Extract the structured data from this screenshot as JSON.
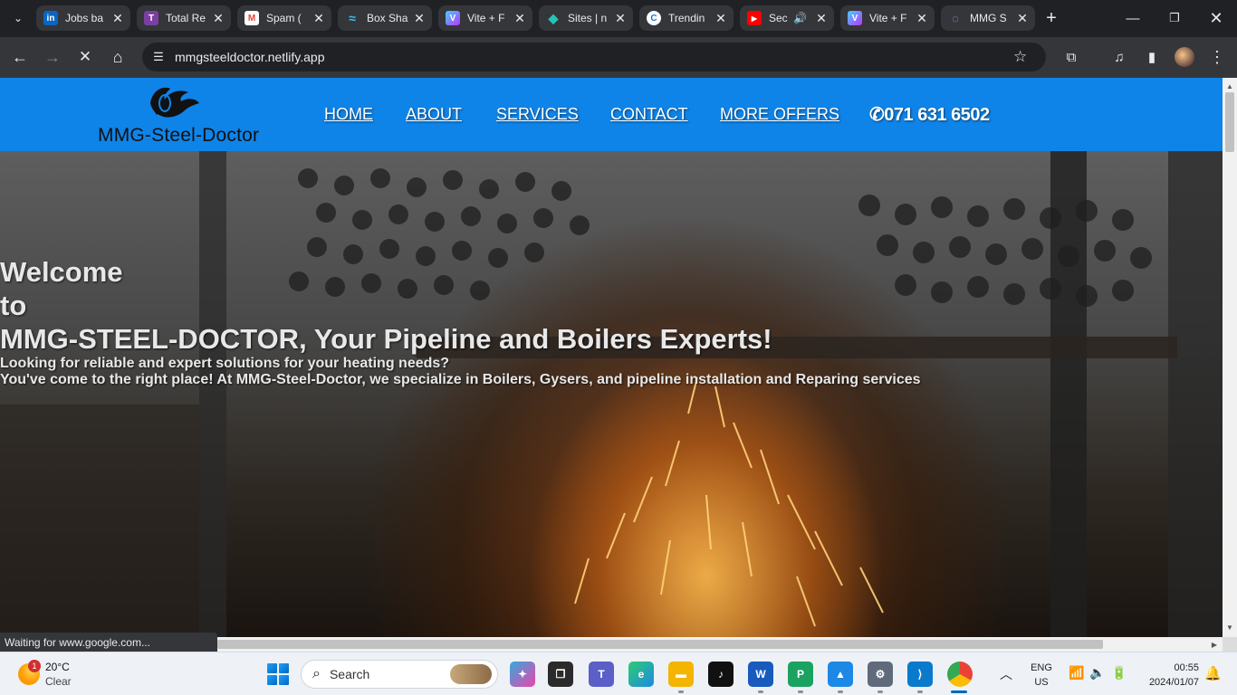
{
  "browser": {
    "tabs": [
      {
        "title": "Jobs ba",
        "icon": "linkedin-icon",
        "color": "#0a66c2",
        "glyph": "in"
      },
      {
        "title": "Total Re",
        "icon": "total-recall-icon",
        "color": "#7b3fa0",
        "glyph": "T"
      },
      {
        "title": "Spam (",
        "icon": "gmail-icon",
        "color": "#ea4335",
        "glyph": "M"
      },
      {
        "title": "Box Sha",
        "icon": "tailwind-icon",
        "color": "#38bdf8",
        "glyph": "~"
      },
      {
        "title": "Vite + F",
        "icon": "vite-icon",
        "color": "#8f6bff",
        "glyph": "V"
      },
      {
        "title": "Sites | n",
        "icon": "netlify-icon",
        "color": "#20c6b6",
        "glyph": "◆"
      },
      {
        "title": "Trendin",
        "icon": "trending-icon",
        "color": "#1a73e8",
        "glyph": "C"
      },
      {
        "title": "Sec",
        "icon": "youtube-icon",
        "color": "#ff0000",
        "glyph": "▶"
      },
      {
        "title": "Vite + F",
        "icon": "vite-icon",
        "color": "#8f6bff",
        "glyph": "V"
      },
      {
        "title": "MMG S",
        "icon": "loading-icon",
        "color": "#5f6368",
        "glyph": "◌"
      }
    ],
    "url": "mmgsteeldoctor.netlify.app",
    "status_text": "Waiting for www.google.com..."
  },
  "site": {
    "logo_text": "MMG-Steel-Doctor",
    "nav": [
      "HOME",
      "ABOUT",
      "SERVICES",
      "CONTACT",
      "MORE OFFERS"
    ],
    "phone": "071 631 6502",
    "hero": {
      "line1": "Welcome",
      "line2": "to",
      "line3": "MMG-STEEL-DOCTOR, Your Pipeline and Boilers Experts!",
      "line4": "Looking for reliable and expert solutions for your heating needs?",
      "line5": "You've come to the right place! At MMG-Steel-Doctor, we specialize in Boilers, Gysers, and pipeline installation and Reparing services"
    }
  },
  "taskbar": {
    "weather_temp": "20°C",
    "weather_desc": "Clear",
    "weather_badge": "1",
    "search_label": "Search",
    "lang": "ENG",
    "region": "US",
    "time": "00:55",
    "date": "2024/01/07"
  }
}
